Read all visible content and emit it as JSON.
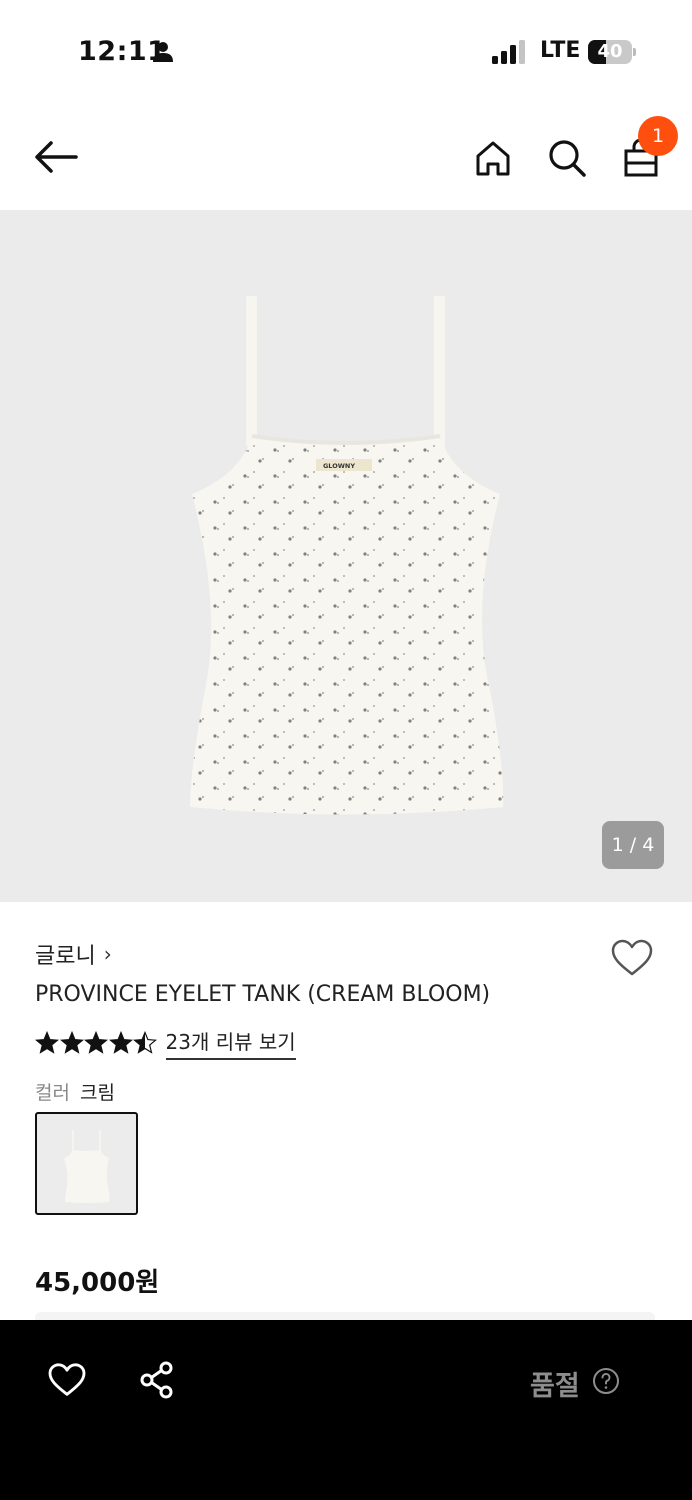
{
  "status_bar": {
    "time": "12:11",
    "network": "LTE",
    "battery": "40",
    "battery_level": 0.4,
    "icons": [
      "person-icon",
      "signal-icon",
      "battery-icon"
    ]
  },
  "nav": {
    "icons": [
      "back-arrow-icon",
      "home-icon",
      "search-icon",
      "shopping-bag-icon"
    ],
    "cart_count": "1",
    "badge_color": "#ff4f0f"
  },
  "gallery": {
    "counter": "1 / 4",
    "label_text": "GLOWNY"
  },
  "product": {
    "brand": "글로니",
    "brand_chevron": "›",
    "title": "PROVINCE EYELET TANK (CREAM BLOOM)",
    "rating": 4.5,
    "rating_max": 5,
    "review_link": "23개 리뷰 보기",
    "color_label": "컬러",
    "color_value": "크림",
    "price": "45,000원"
  },
  "bottom_bar": {
    "soldout": "품절",
    "icons": [
      "heart-icon",
      "share-icon",
      "help-circle-icon"
    ]
  },
  "colors": {
    "accent": "#ff4f0f",
    "bottom_bar_bg": "#000000",
    "gallery_bg": "#ebebeb",
    "soldout_text": "#8d8d8d"
  }
}
